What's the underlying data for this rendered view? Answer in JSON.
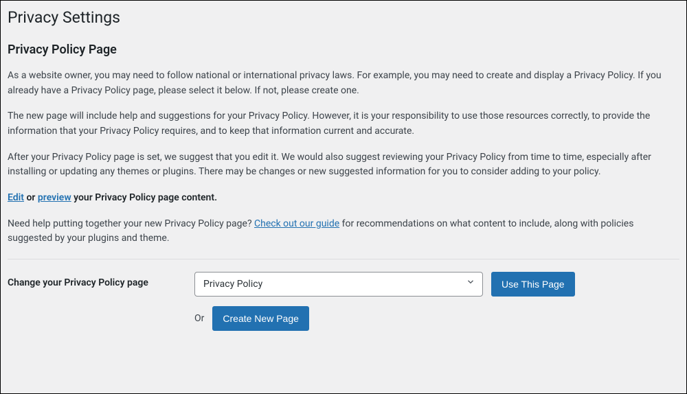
{
  "page": {
    "title": "Privacy Settings",
    "subtitle": "Privacy Policy Page"
  },
  "paragraphs": {
    "p1": "As a website owner, you may need to follow national or international privacy laws. For example, you may need to create and display a Privacy Policy. If you already have a Privacy Policy page, please select it below. If not, please create one.",
    "p2": "The new page will include help and suggestions for your Privacy Policy. However, it is your responsibility to use those resources correctly, to provide the information that your Privacy Policy requires, and to keep that information current and accurate.",
    "p3": "After your Privacy Policy page is set, we suggest that you edit it. We would also suggest reviewing your Privacy Policy from time to time, especially after installing or updating any themes or plugins. There may be changes or new suggested information for you to consider adding to your policy."
  },
  "editLine": {
    "editLink": "Edit",
    "orText": " or ",
    "previewLink": "preview",
    "restText": " your Privacy Policy page content."
  },
  "guideLine": {
    "prefix": "Need help putting together your new Privacy Policy page? ",
    "link": "Check out our guide",
    "suffix": " for recommendations on what content to include, along with policies suggested by your plugins and theme."
  },
  "form": {
    "label": "Change your Privacy Policy page",
    "selectValue": "Privacy Policy",
    "useButton": "Use This Page",
    "orText": "Or",
    "createButton": "Create New Page"
  }
}
